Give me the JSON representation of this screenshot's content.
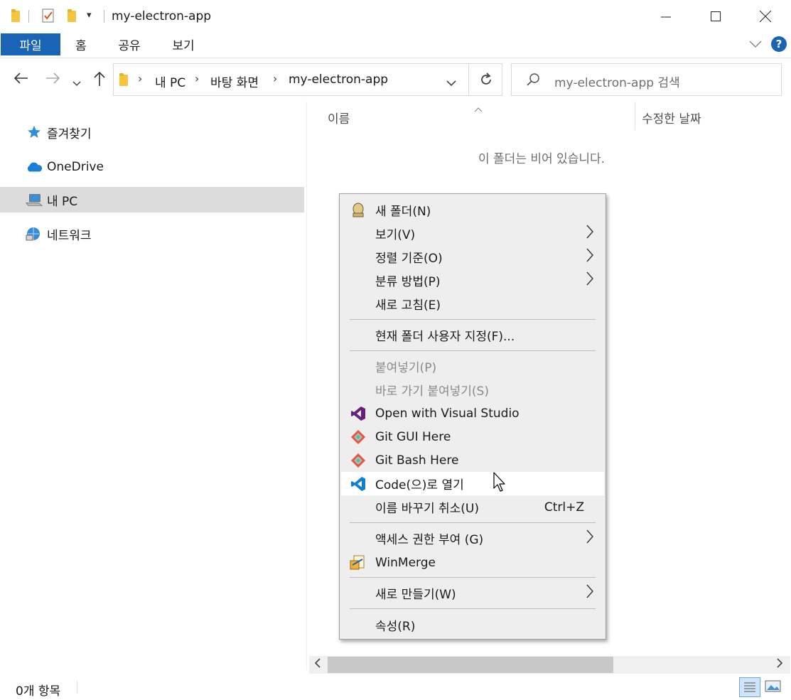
{
  "window": {
    "title": "my-electron-app",
    "controls": {
      "minimize": "—",
      "maximize": "☐",
      "close": "✕"
    }
  },
  "ribbon": {
    "tabs": [
      {
        "label": "파일"
      },
      {
        "label": "홈"
      },
      {
        "label": "공유"
      },
      {
        "label": "보기"
      }
    ]
  },
  "address": {
    "breadcrumbs": [
      "내 PC",
      "바탕 화면",
      "my-electron-app"
    ]
  },
  "search": {
    "placeholder": "my-electron-app 검색"
  },
  "sidebar": {
    "items": [
      {
        "label": "즐겨찾기",
        "icon": "star-icon"
      },
      {
        "label": "OneDrive",
        "icon": "cloud-icon"
      },
      {
        "label": "내 PC",
        "icon": "pc-icon",
        "selected": true
      },
      {
        "label": "네트워크",
        "icon": "network-icon"
      }
    ]
  },
  "content": {
    "columns": [
      "이름",
      "수정한 날짜"
    ],
    "empty_message": "이 폴더는 비어 있습니다."
  },
  "status": {
    "item_count": "0개 항목"
  },
  "context_menu": {
    "items": [
      {
        "label": "새 폴더(N)",
        "icon": "new-folder-icon"
      },
      {
        "label": "보기(V)",
        "submenu": true
      },
      {
        "label": "정렬 기준(O)",
        "submenu": true
      },
      {
        "label": "분류 방법(P)",
        "submenu": true
      },
      {
        "label": "새로 고침(E)"
      },
      {
        "label": "현재 폴더 사용자 지정(F)..."
      },
      {
        "label": "붙여넣기(P)",
        "disabled": true
      },
      {
        "label": "바로 가기 붙여넣기(S)",
        "disabled": true
      },
      {
        "label": "Open with Visual Studio",
        "icon": "visual-studio-icon"
      },
      {
        "label": "Git GUI Here",
        "icon": "git-icon"
      },
      {
        "label": "Git Bash Here",
        "icon": "git-icon"
      },
      {
        "label": "Code(으)로 열기",
        "icon": "vscode-icon",
        "hover": true
      },
      {
        "label": "이름 바꾸기 취소(U)",
        "shortcut": "Ctrl+Z"
      },
      {
        "label": "액세스 권한 부여 (G)",
        "submenu": true
      },
      {
        "label": "WinMerge",
        "icon": "winmerge-icon"
      },
      {
        "label": "새로 만들기(W)",
        "submenu": true
      },
      {
        "label": "속성(R)"
      }
    ]
  },
  "colors": {
    "file_tab": "#1a64b5",
    "selection": "#dcdcdc",
    "menu_bg": "#eeeeee",
    "help": "#1a64b5"
  }
}
